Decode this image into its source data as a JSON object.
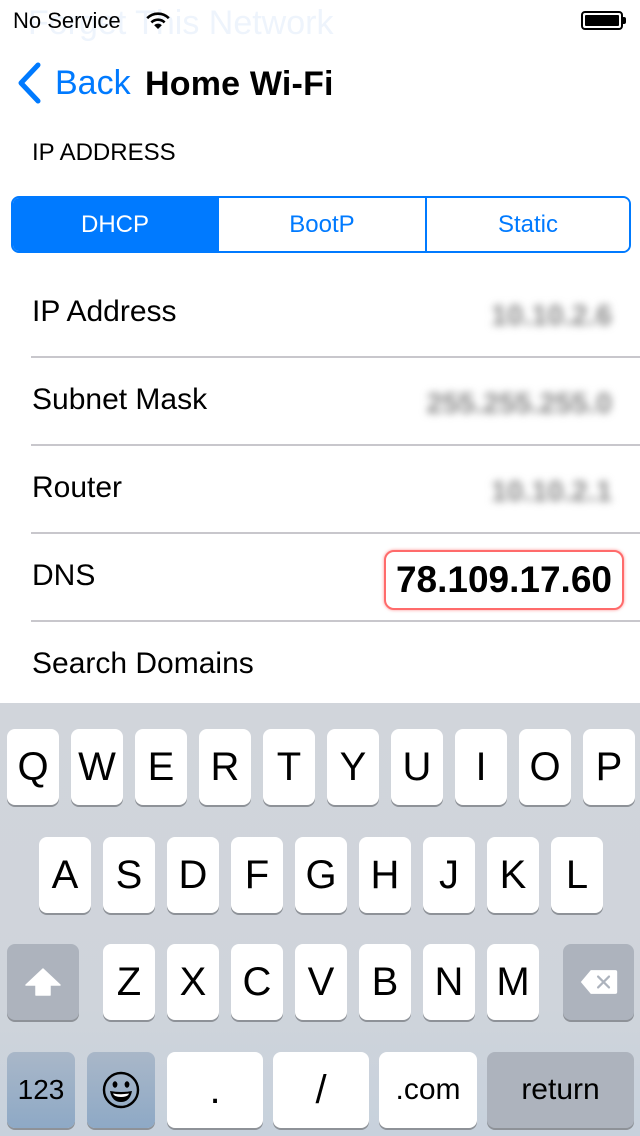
{
  "background_text": "Forget This Network",
  "status_bar": {
    "carrier": "No Service",
    "wifi_icon": "wifi-icon",
    "battery_icon": "battery-full-icon",
    "battery_level_percent": 100
  },
  "nav": {
    "back_label": "Back",
    "back_icon": "chevron-left-icon",
    "title": "Home Wi-Fi"
  },
  "section_header": "IP ADDRESS",
  "segmented": {
    "options": [
      "DHCP",
      "BootP",
      "Static"
    ],
    "selected": "DHCP"
  },
  "rows": [
    {
      "label": "IP Address",
      "value": "10.10.2.6",
      "blurred": true
    },
    {
      "label": "Subnet Mask",
      "value": "255.255.255.0",
      "blurred": true
    },
    {
      "label": "Router",
      "value": "10.10.2.1",
      "blurred": true
    },
    {
      "label": "DNS",
      "value": "78.109.17.60",
      "editing": true
    },
    {
      "label": "Search Domains",
      "value": ""
    }
  ],
  "colors": {
    "accent": "#007aff",
    "highlight_border": "#ff6b6b",
    "divider": "#c8c7cc",
    "keyboard_bg": "#d1d5db"
  },
  "keyboard": {
    "row1": [
      "Q",
      "W",
      "E",
      "R",
      "T",
      "Y",
      "U",
      "I",
      "O",
      "P"
    ],
    "row2": [
      "A",
      "S",
      "D",
      "F",
      "G",
      "H",
      "J",
      "K",
      "L"
    ],
    "row3": [
      "Z",
      "X",
      "C",
      "V",
      "B",
      "N",
      "M"
    ],
    "shift_icon": "shift-arrow-icon",
    "delete_icon": "backspace-icon",
    "numbers_label": "123",
    "emoji_icon": "emoji-smiley-icon",
    "dot_label": ".",
    "slash_label": "/",
    "dotcom_label": ".com",
    "return_label": "return"
  }
}
